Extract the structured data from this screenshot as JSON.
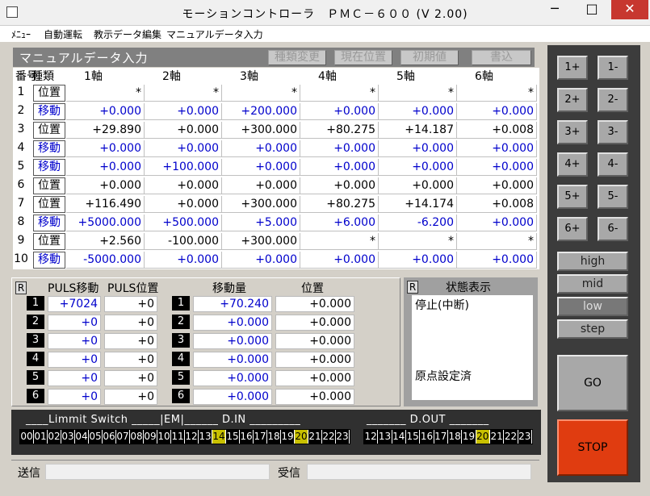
{
  "window": {
    "title": "モーションコントローラ　ＰＭＣ－６００ (V 2.00)",
    "min": "─",
    "max": "□",
    "close": "✕"
  },
  "menu": [
    "ﾒﾆｭｰ",
    "自動運転",
    "教示データ編集",
    "マニュアルデータ入力"
  ],
  "manual": {
    "title": "マニュアルデータ入力",
    "buttons": [
      "種類変更",
      "現在位置",
      "初期値",
      "書込"
    ],
    "headers": [
      "番号",
      "種類",
      "1軸",
      "2軸",
      "3軸",
      "4軸",
      "5軸",
      "6軸"
    ],
    "rows": [
      {
        "no": "1",
        "type": "位置",
        "move": false,
        "v": [
          "*",
          "*",
          "*",
          "*",
          "*",
          "*"
        ]
      },
      {
        "no": "2",
        "type": "移動",
        "move": true,
        "v": [
          "+0.000",
          "+0.000",
          "+200.000",
          "+0.000",
          "+0.000",
          "+0.000"
        ]
      },
      {
        "no": "3",
        "type": "位置",
        "move": false,
        "v": [
          "+29.890",
          "+0.000",
          "+300.000",
          "+80.275",
          "+14.187",
          "+0.008"
        ]
      },
      {
        "no": "4",
        "type": "移動",
        "move": true,
        "v": [
          "+0.000",
          "+0.000",
          "+0.000",
          "+0.000",
          "+0.000",
          "+0.000"
        ]
      },
      {
        "no": "5",
        "type": "移動",
        "move": true,
        "v": [
          "+0.000",
          "+100.000",
          "+0.000",
          "+0.000",
          "+0.000",
          "+0.000"
        ]
      },
      {
        "no": "6",
        "type": "位置",
        "move": false,
        "v": [
          "+0.000",
          "+0.000",
          "+0.000",
          "+0.000",
          "+0.000",
          "+0.000"
        ]
      },
      {
        "no": "7",
        "type": "位置",
        "move": false,
        "v": [
          "+116.490",
          "+0.000",
          "+300.000",
          "+80.275",
          "+14.174",
          "+0.008"
        ]
      },
      {
        "no": "8",
        "type": "移動",
        "move": true,
        "v": [
          "+5000.000",
          "+500.000",
          "+5.000",
          "+6.000",
          "-6.200",
          "+0.000"
        ]
      },
      {
        "no": "9",
        "type": "位置",
        "move": false,
        "v": [
          "+2.560",
          "-100.000",
          "+300.000",
          "*",
          "*",
          "*"
        ]
      },
      {
        "no": "10",
        "type": "移動",
        "move": true,
        "v": [
          "-5000.000",
          "+0.000",
          "+0.000",
          "+0.000",
          "+0.000",
          "+0.000"
        ]
      }
    ]
  },
  "puls": {
    "r": "R",
    "headers": [
      "PULS移動",
      "PULS位置",
      "移動量",
      "位置"
    ],
    "axes": [
      "1",
      "2",
      "3",
      "4",
      "5",
      "6"
    ],
    "puls_move": [
      "+7024",
      "+0",
      "+0",
      "+0",
      "+0",
      "+0"
    ],
    "puls_pos": [
      "+0",
      "+0",
      "+0",
      "+0",
      "+0",
      "+0"
    ],
    "move_amt": [
      "+70.240",
      "+0.000",
      "+0.000",
      "+0.000",
      "+0.000",
      "+0.000"
    ],
    "pos": [
      "+0.000",
      "+0.000",
      "+0.000",
      "+0.000",
      "+0.000",
      "+0.000"
    ]
  },
  "status": {
    "r": "R",
    "title": "状態表示",
    "line1": "停止(中断)",
    "line2": "原点設定済"
  },
  "io": {
    "limit_label": "____Limmit Switch _____|EM|______ D.IN _________",
    "dout_label": "_______ D.OUT _______",
    "in_bits": [
      "00",
      "01",
      "02",
      "03",
      "04",
      "05",
      "06",
      "07",
      "08",
      "09",
      "10",
      "11",
      "12",
      "13",
      "14",
      "15",
      "16",
      "17",
      "18",
      "19",
      "20",
      "21",
      "22",
      "23"
    ],
    "in_on": [
      "14",
      "20"
    ],
    "out_bits": [
      "12",
      "13",
      "14",
      "15",
      "16",
      "17",
      "18",
      "19",
      "20",
      "21",
      "22",
      "23"
    ],
    "out_on": [
      "20"
    ]
  },
  "comm": {
    "send": "送信",
    "recv": "受信"
  },
  "jog": [
    "1+",
    "1-",
    "2+",
    "2-",
    "3+",
    "3-",
    "4+",
    "4-",
    "5+",
    "5-",
    "6+",
    "6-"
  ],
  "speeds": [
    "high",
    "mid",
    "low",
    "step"
  ],
  "speed_selected": "low",
  "go": "GO",
  "stop": "STOP"
}
